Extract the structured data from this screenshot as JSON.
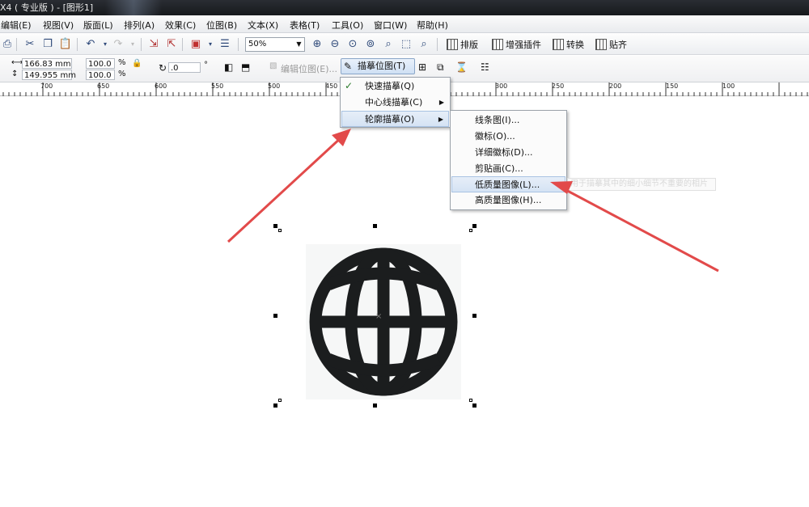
{
  "window": {
    "title": "X4 ( 专业版 ) - [图形1]"
  },
  "menubar": {
    "items": [
      "编辑(E)",
      "视图(V)",
      "版面(L)",
      "排列(A)",
      "效果(C)",
      "位图(B)",
      "文本(X)",
      "表格(T)",
      "工具(O)",
      "窗口(W)",
      "帮助(H)"
    ]
  },
  "toolbar": {
    "zoom_value": "50%",
    "plugins": [
      "排版",
      "增强插件",
      "转换",
      "贴齐"
    ]
  },
  "propbar": {
    "width_value": "166.83 mm",
    "height_value": "149.955 mm",
    "scale_x": "100.0",
    "scale_y": "100.0",
    "percent": "%",
    "rotation": ".0",
    "degree": "°",
    "edit_bitmap_label": "编辑位图(E)...",
    "trace_bitmap_label": "描摹位图(T)"
  },
  "ruler": {
    "labels": [
      "700",
      "650",
      "600",
      "550",
      "500",
      "450",
      "300",
      "250",
      "200",
      "150",
      "100"
    ]
  },
  "trace_menu": {
    "items": [
      "快速描摹(Q)",
      "中心线描摹(C)",
      "轮廓描摹(O)"
    ]
  },
  "outline_submenu": {
    "items": [
      "线条图(I)...",
      "徽标(O)...",
      "详细徽标(D)...",
      "剪贴画(C)...",
      "低质量图像(L)...",
      "高质量图像(H)..."
    ],
    "highlighted": "低质量图像(L)..."
  },
  "tooltip": {
    "text": "用于描摹其中的细小细节不重要的相片"
  },
  "colors": {
    "arrow": "#e24a4a",
    "highlight": "#d5e3f4",
    "globe": "#1b1d1e"
  }
}
